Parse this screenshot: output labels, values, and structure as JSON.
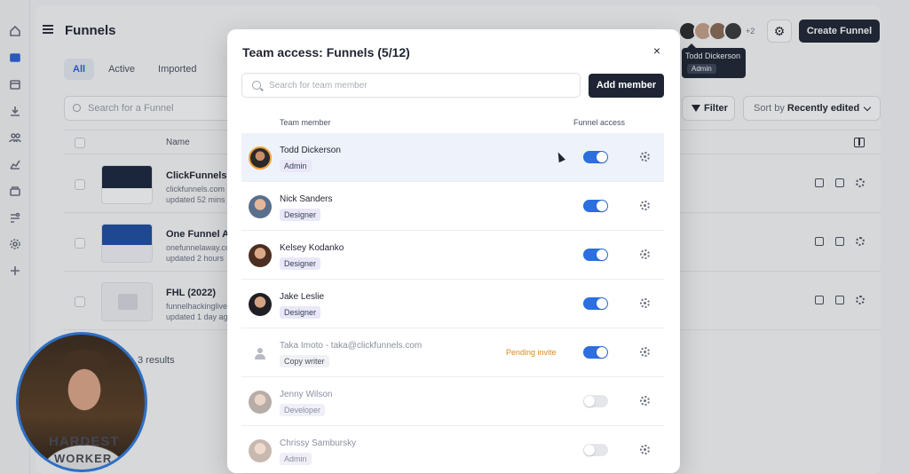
{
  "header": {
    "page_title": "Funnels",
    "avatar_more": "+2",
    "create_label": "Create Funnel",
    "tooltip": {
      "name": "Todd Dickerson",
      "role": "Admin"
    }
  },
  "tabs": [
    "All",
    "Active",
    "Imported"
  ],
  "toolbar": {
    "search_placeholder": "Search for a Funnel",
    "filter_label": "Filter",
    "sort_prefix": "Sort by",
    "sort_value": "Recently edited"
  },
  "table": {
    "name_header": "Name",
    "rows": [
      {
        "name": "ClickFunnels (",
        "url": "clickfunnels.com",
        "updated": "updated 52 mins"
      },
      {
        "name": "One Funnel Av",
        "url": "onefunnelaway.com",
        "updated": "updated 2 hours"
      },
      {
        "name": "FHL (2022)",
        "url": "funnelhackinglive",
        "updated": "updated 1 day ag"
      }
    ],
    "results": "3 results"
  },
  "modal": {
    "title": "Team access: Funnels (5/12)",
    "close": "×",
    "search_placeholder": "Search for team member",
    "add_label": "Add member",
    "col_member": "Team member",
    "col_access": "Funnel access",
    "members": [
      {
        "name": "Todd Dickerson",
        "email": "",
        "role": "Admin",
        "pending": "",
        "access": true
      },
      {
        "name": "Nick Sanders",
        "email": "",
        "role": "Designer",
        "pending": "",
        "access": true
      },
      {
        "name": "Kelsey Kodanko",
        "email": "",
        "role": "Designer",
        "pending": "",
        "access": true
      },
      {
        "name": "Jake Leslie",
        "email": "",
        "role": "Designer",
        "pending": "",
        "access": true
      },
      {
        "name": "Taka Imoto",
        "email": " - taka@clickfunnels.com",
        "role": "Copy writer",
        "pending": "Pending invite",
        "access": true
      },
      {
        "name": "Jenny Wilson",
        "email": "",
        "role": "Developer",
        "pending": "",
        "access": false
      },
      {
        "name": "Chrissy Sambursky",
        "email": "",
        "role": "Admin",
        "pending": "",
        "access": false
      }
    ]
  },
  "webcam": {
    "shirt_line1": "HARDEST",
    "shirt_line2": "WORKER"
  },
  "colors": {
    "accent": "#2b6fe0",
    "dark_button": "#1e2433",
    "pending": "#d98a1f",
    "role_badge": "#e8e8f8"
  },
  "icons": [
    "home-icon",
    "funnels-icon",
    "calendar-icon",
    "download-icon",
    "contacts-icon",
    "analytics-icon",
    "products-icon",
    "automation-icon",
    "settings-icon",
    "plus-icon"
  ]
}
